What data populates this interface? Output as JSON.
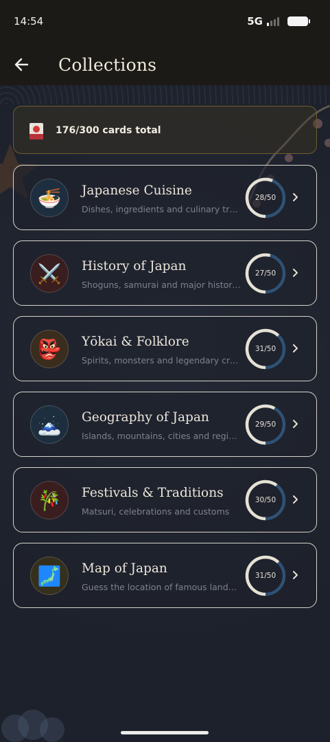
{
  "status_bar": {
    "time": "14:54",
    "network": "5G"
  },
  "header": {
    "title": "Collections"
  },
  "summary": {
    "text": "176/300 cards total"
  },
  "collections": [
    {
      "title": "Japanese Cuisine",
      "subtitle": "Dishes, ingredients and culinary traditions",
      "progress_label": "28/50",
      "progress": 0.56,
      "icon": "ramen-bowl-icon",
      "glyph": "🍜",
      "icon_bg": "#1d2f3f"
    },
    {
      "title": "History of Japan",
      "subtitle": "Shoguns, samurai and major historical events",
      "progress_label": "27/50",
      "progress": 0.54,
      "icon": "crossed-swords-icon",
      "glyph": "⚔️",
      "icon_bg": "#3a1d1f"
    },
    {
      "title": "Yōkai & Folklore",
      "subtitle": "Spirits, monsters and legendary creatures",
      "progress_label": "31/50",
      "progress": 0.62,
      "icon": "oni-mask-icon",
      "glyph": "👺",
      "icon_bg": "#3a2d1e"
    },
    {
      "title": "Geography of Japan",
      "subtitle": "Islands, mountains, cities and regions",
      "progress_label": "29/50",
      "progress": 0.58,
      "icon": "mount-fuji-icon",
      "glyph": "🗻",
      "icon_bg": "#1d2f3f"
    },
    {
      "title": "Festivals & Traditions",
      "subtitle": "Matsuri, celebrations and customs",
      "progress_label": "30/50",
      "progress": 0.6,
      "icon": "tanabata-tree-icon",
      "glyph": "🎋",
      "icon_bg": "#3a1d1f"
    },
    {
      "title": "Map of Japan",
      "subtitle": "Guess the location of famous landmarks",
      "progress_label": "31/50",
      "progress": 0.62,
      "icon": "japan-map-icon",
      "glyph": "🗾",
      "icon_bg": "#34301c"
    }
  ],
  "colors": {
    "ring_track": "#2f5275",
    "ring_fill": "#e6e1d4",
    "summary_border": "#6e5d2f",
    "card_border": "#d9d5cc"
  }
}
